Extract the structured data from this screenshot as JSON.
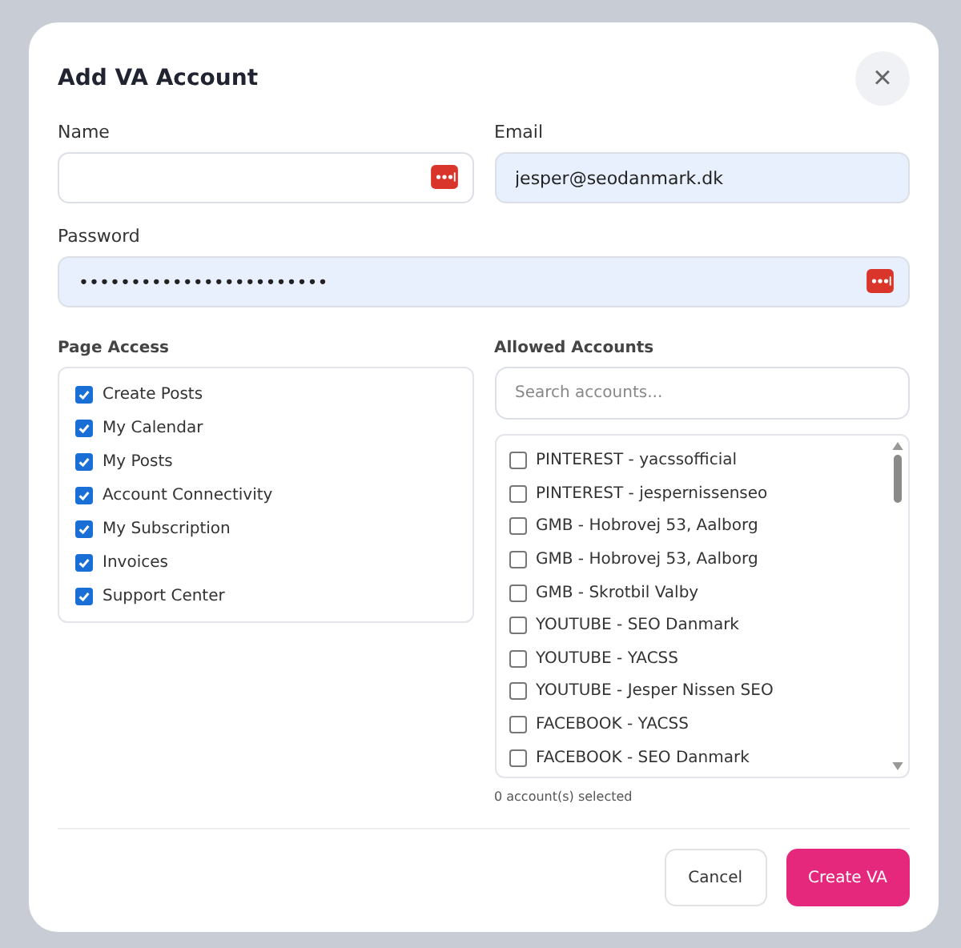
{
  "dialog": {
    "title": "Add VA Account",
    "close_icon": "×"
  },
  "fields": {
    "name": {
      "label": "Name",
      "autofilled": false
    },
    "email": {
      "label": "Email",
      "value": "jesper@seodanmark.dk",
      "autofilled": true
    },
    "password": {
      "label": "Password",
      "value": "••••••••••••••••••••••••",
      "autofilled": true
    }
  },
  "page_access": {
    "label": "Page Access",
    "items": [
      {
        "label": "Create Posts",
        "checked": true
      },
      {
        "label": "My Calendar",
        "checked": true
      },
      {
        "label": "My Posts",
        "checked": true
      },
      {
        "label": "Account Connectivity",
        "checked": true
      },
      {
        "label": "My Subscription",
        "checked": true
      },
      {
        "label": "Invoices",
        "checked": true
      },
      {
        "label": "Support Center",
        "checked": true
      }
    ]
  },
  "allowed_accounts": {
    "label": "Allowed Accounts",
    "search": {
      "placeholder": "Search accounts..."
    },
    "items": [
      {
        "label": "PINTEREST - yacssofficial",
        "checked": false
      },
      {
        "label": "PINTEREST - jespernissenseo",
        "checked": false
      },
      {
        "label": "GMB - Hobrovej 53, Aalborg",
        "checked": false
      },
      {
        "label": "GMB - Hobrovej 53, Aalborg",
        "checked": false
      },
      {
        "label": "GMB - Skrotbil Valby",
        "checked": false
      },
      {
        "label": "YOUTUBE - SEO Danmark",
        "checked": false
      },
      {
        "label": "YOUTUBE - YACSS",
        "checked": false
      },
      {
        "label": "YOUTUBE - Jesper Nissen SEO",
        "checked": false
      },
      {
        "label": "FACEBOOK - YACSS",
        "checked": false
      },
      {
        "label": "FACEBOOK - SEO Danmark",
        "checked": false
      }
    ],
    "selected_count": "0 account(s) selected"
  },
  "buttons": {
    "cancel": "Cancel",
    "create": "Create VA"
  }
}
